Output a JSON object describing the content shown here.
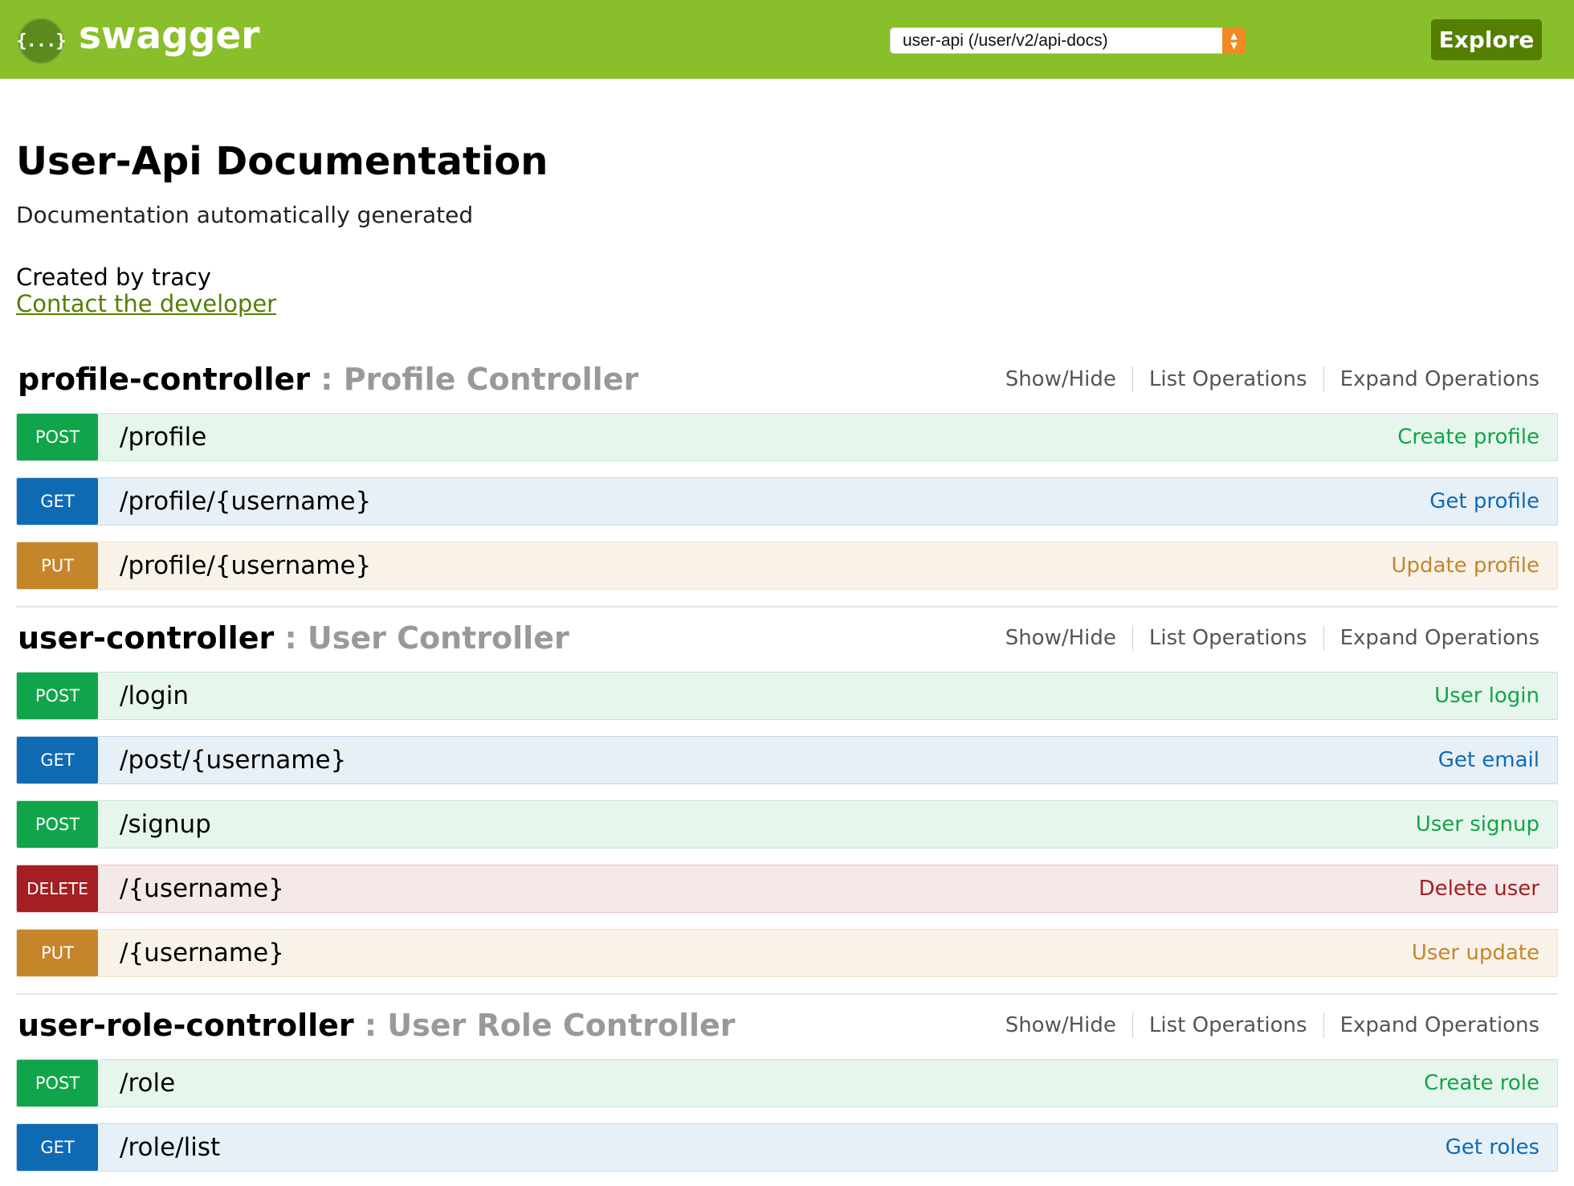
{
  "header": {
    "logo_glyph": "{...}",
    "logo_text": "swagger",
    "api_select_value": "user-api (/user/v2/api-docs)",
    "explore_label": "Explore"
  },
  "info": {
    "title": "User-Api Documentation",
    "description": "Documentation automatically generated",
    "created_by": "Created by tracy",
    "contact_link": "Contact the developer"
  },
  "controllers": [
    {
      "name": "profile-controller",
      "description": " : Profile Controller",
      "ops": [
        "Show/Hide",
        "List Operations",
        "Expand Operations"
      ],
      "endpoints": [
        {
          "method": "POST",
          "path": "/profile",
          "summary": "Create profile"
        },
        {
          "method": "GET",
          "path": "/profile/{username}",
          "summary": "Get profile"
        },
        {
          "method": "PUT",
          "path": "/profile/{username}",
          "summary": "Update profile"
        }
      ]
    },
    {
      "name": "user-controller",
      "description": " : User Controller",
      "ops": [
        "Show/Hide",
        "List Operations",
        "Expand Operations"
      ],
      "endpoints": [
        {
          "method": "POST",
          "path": "/login",
          "summary": "User login"
        },
        {
          "method": "GET",
          "path": "/post/{username}",
          "summary": "Get email"
        },
        {
          "method": "POST",
          "path": "/signup",
          "summary": "User signup"
        },
        {
          "method": "DELETE",
          "path": "/{username}",
          "summary": "Delete user"
        },
        {
          "method": "PUT",
          "path": "/{username}",
          "summary": "User update"
        }
      ]
    },
    {
      "name": "user-role-controller",
      "description": " : User Role Controller",
      "ops": [
        "Show/Hide",
        "List Operations",
        "Expand Operations"
      ],
      "endpoints": [
        {
          "method": "POST",
          "path": "/role",
          "summary": "Create role"
        },
        {
          "method": "GET",
          "path": "/role/list",
          "summary": "Get roles"
        }
      ]
    }
  ],
  "colors": {
    "header_bg": "#89bf2a",
    "explore_bg": "#547f00",
    "post": "#10a54a",
    "get": "#0f6ab4",
    "put": "#c5862b",
    "delete": "#a41e22"
  }
}
